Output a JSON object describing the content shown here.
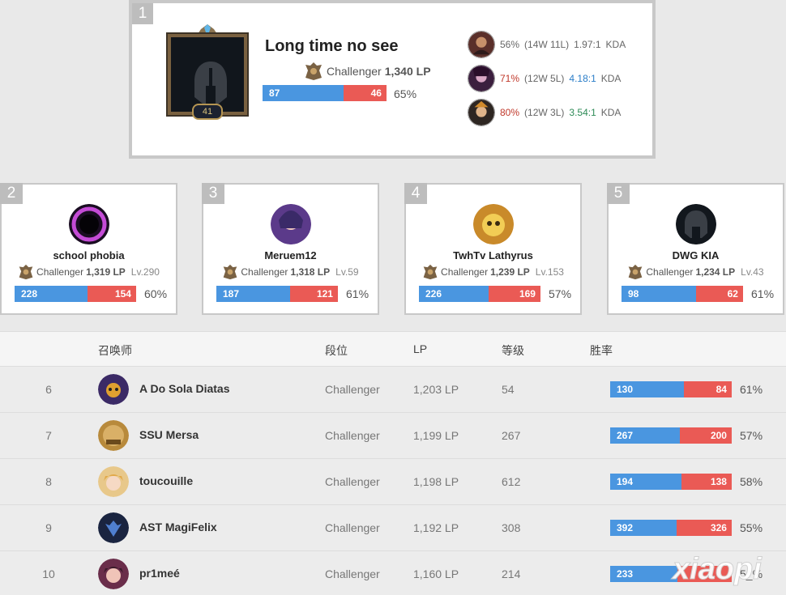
{
  "top": {
    "rank": "1",
    "name": "Long time no see",
    "tier": "Challenger",
    "lp": "1,340 LP",
    "level": "41",
    "wins": "87",
    "losses": "46",
    "win_fraction": 0.654,
    "winrate": "65%",
    "champions": [
      {
        "name_icon": "champion-1-portrait",
        "rate": "56%",
        "record": "(14W 11L)",
        "kda": "1.97:1",
        "kda_suffix": "KDA",
        "rate_color": "#666666",
        "kda_color": "#666666"
      },
      {
        "name_icon": "champion-2-portrait",
        "rate": "71%",
        "record": "(12W 5L)",
        "kda": "4.18:1",
        "kda_suffix": "KDA",
        "rate_color": "#c0392b",
        "kda_color": "#2a7dc8"
      },
      {
        "name_icon": "champion-3-portrait",
        "rate": "80%",
        "record": "(12W 3L)",
        "kda": "3.54:1",
        "kda_suffix": "KDA",
        "rate_color": "#c0392b",
        "kda_color": "#2e8b57"
      }
    ]
  },
  "cards": [
    {
      "rank": "2",
      "name": "school phobia",
      "tier": "Challenger",
      "lp": "1,319 LP",
      "level": "Lv.290",
      "wins": "228",
      "losses": "154",
      "win_fraction": 0.597,
      "winrate": "60%"
    },
    {
      "rank": "3",
      "name": "Meruem12",
      "tier": "Challenger",
      "lp": "1,318 LP",
      "level": "Lv.59",
      "wins": "187",
      "losses": "121",
      "win_fraction": 0.607,
      "winrate": "61%"
    },
    {
      "rank": "4",
      "name": "TwhTv Lathyrus",
      "tier": "Challenger",
      "lp": "1,239 LP",
      "level": "Lv.153",
      "wins": "226",
      "losses": "169",
      "win_fraction": 0.572,
      "winrate": "57%"
    },
    {
      "rank": "5",
      "name": "DWG KIA",
      "tier": "Challenger",
      "lp": "1,234 LP",
      "level": "Lv.43",
      "wins": "98",
      "losses": "62",
      "win_fraction": 0.613,
      "winrate": "61%"
    }
  ],
  "table": {
    "headers": {
      "summoner": "召唤师",
      "tier": "段位",
      "lp": "LP",
      "level": "等级",
      "winrate": "胜率"
    },
    "rows": [
      {
        "rank": "6",
        "name": "A Do Sola Diatas",
        "tier": "Challenger",
        "lp": "1,203 LP",
        "level": "54",
        "wins": "130",
        "losses": "84",
        "win_fraction": 0.607,
        "winrate": "61%"
      },
      {
        "rank": "7",
        "name": "SSU Mersa",
        "tier": "Challenger",
        "lp": "1,199 LP",
        "level": "267",
        "wins": "267",
        "losses": "200",
        "win_fraction": 0.572,
        "winrate": "57%"
      },
      {
        "rank": "8",
        "name": "toucouille",
        "tier": "Challenger",
        "lp": "1,198 LP",
        "level": "612",
        "wins": "194",
        "losses": "138",
        "win_fraction": 0.584,
        "winrate": "58%"
      },
      {
        "rank": "9",
        "name": "AST MagiFelix",
        "tier": "Challenger",
        "lp": "1,192 LP",
        "level": "308",
        "wins": "392",
        "losses": "326",
        "win_fraction": 0.546,
        "winrate": "55%"
      },
      {
        "rank": "10",
        "name": "pr1meé",
        "tier": "Challenger",
        "lp": "1,160 LP",
        "level": "214",
        "wins": "233",
        "losses": "",
        "win_fraction": 0.55,
        "winrate": "5_%"
      }
    ]
  },
  "colors": {
    "win": "#4a96e0",
    "loss": "#ea5a55",
    "badge": "#bdbdbd"
  },
  "watermark_text": "xiaopi"
}
